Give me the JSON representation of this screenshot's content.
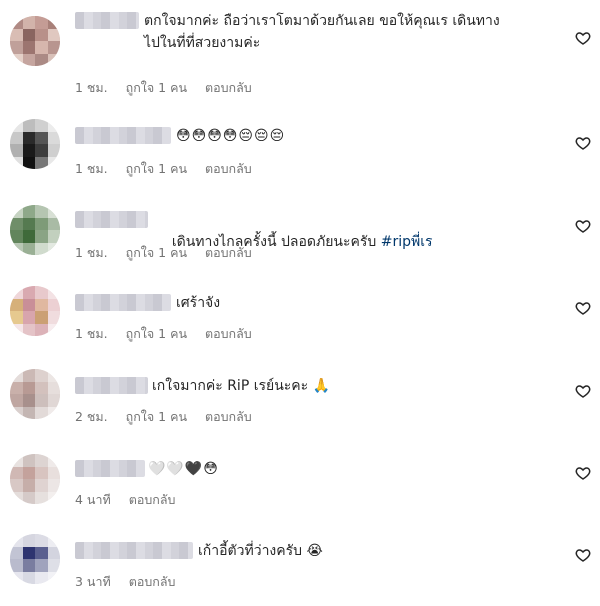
{
  "comments": [
    {
      "text": "ตกใจมากค่ะ ถือว่าเราโตมาด้วยกันเลย ขอให้คุณเร เดินทาง\nไปในที่ที่สวยงามค่ะ",
      "time": "1 ชม.",
      "likes": "ถูกใจ 1 คน",
      "reply": "ตอบกลับ"
    },
    {
      "text": "😳😳😳😳😔😔😔",
      "time": "1 ชม.",
      "likes": "ถูกใจ 1 คน",
      "reply": "ตอบกลับ"
    },
    {
      "text": "เดินทางไกลครั้งนี้ ปลอดภัยนะครับ ",
      "hashtag": "#ripพี่เร",
      "time": "1 ชม.",
      "likes": "ถูกใจ 1 คน",
      "reply": "ตอบกลับ"
    },
    {
      "text": "เศร้าจัง",
      "time": "1 ชม.",
      "likes": "ถูกใจ 1 คน",
      "reply": "ตอบกลับ"
    },
    {
      "text": "เกใจมากค่ะ RiP เรย์นะคะ 🙏",
      "time": "2 ชม.",
      "likes": "ถูกใจ 1 คน",
      "reply": "ตอบกลับ"
    },
    {
      "text": "🤍🤍🖤😳",
      "time": "4 นาที",
      "reply": "ตอบกลับ"
    },
    {
      "text": "เก้าอี้ตัวที่ว่างครับ 😭",
      "time": "3 นาที",
      "reply": "ตอบกลับ"
    }
  ],
  "icons": {
    "like": "heart-outline-icon"
  },
  "colors": {
    "meta": "#737373",
    "hashtag": "#00376b",
    "text": "#262626"
  }
}
